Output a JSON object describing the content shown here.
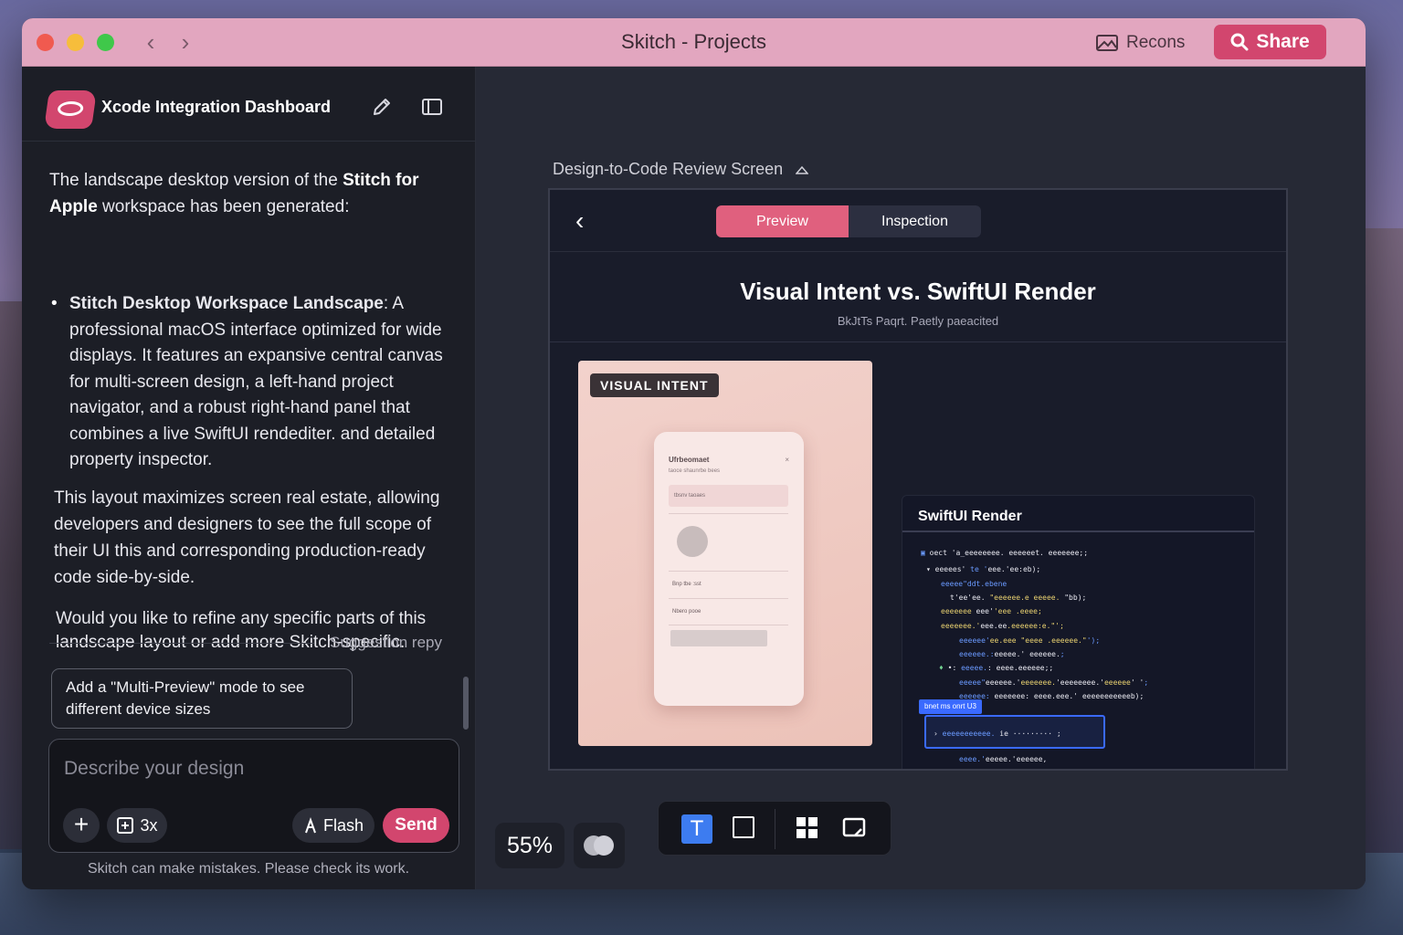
{
  "window": {
    "title": "Skitch  -  Projects",
    "recons_label": "Recons",
    "share_label": "Share"
  },
  "sidebar": {
    "project_title": "Xcode Integration Dashboard",
    "message_intro_a": "The landscape desktop version of the ",
    "message_intro_bold": "Stitch for Apple",
    "message_intro_b": " workspace has been generated:",
    "bullet_title": "Stitch Desktop Workspace Landscape",
    "bullet_text": ": A professional macOS interface optimized for wide displays. It features an expansive central canvas for multi-screen design, a left-hand project navigator, and a robust right-hand panel that combines a live SwiftUI rendediter. and detailed property inspector.",
    "message_2": "This layout maximizes screen real estate, allowing developers and designers to see the full scope of their UI this and corresponding production-ready code side-by-side.",
    "message_3": "Would you like to refine any specific parts of this landscape layout or add more Skitch-specific.",
    "suggestion_label": "Suggestion repy",
    "suggestion_chip": "Add a \"Multi-Preview\" mode to see different device sizes",
    "composer_placeholder": "Describe your design",
    "multiplier_label": "3x",
    "flash_label": "Flash",
    "send_label": "Send",
    "disclaimer": "Skitch can make mistakes. Please check its work."
  },
  "canvas": {
    "frame_label": "Design-to-Code Review Screen",
    "tabs": [
      {
        "label": "Preview",
        "active": true
      },
      {
        "label": "Inspection",
        "active": false
      }
    ],
    "frame_title": "Visual Intent vs. SwiftUI Render",
    "frame_subtitle": "BkJtTs Paqrt. Paetly paeacited",
    "visual_intent_badge": "VISUAL INTENT",
    "phone": {
      "title": "Ufrbeomaet",
      "subtitle": "taoce shaunrbe bees",
      "field": "tbsnv taoaes",
      "x": "×",
      "row1": "Bnp tbe :sst",
      "row2": "Nbero pooe"
    },
    "swiftui_title": "SwiftUI Render",
    "code_tag": "bnet ms onrt U3",
    "zoom": "55%"
  },
  "colors": {
    "accent": "#d2466e",
    "titlebar": "#e2a6bf",
    "selected_tool": "#3d7cf0",
    "preview_tab": "#e0607e"
  }
}
